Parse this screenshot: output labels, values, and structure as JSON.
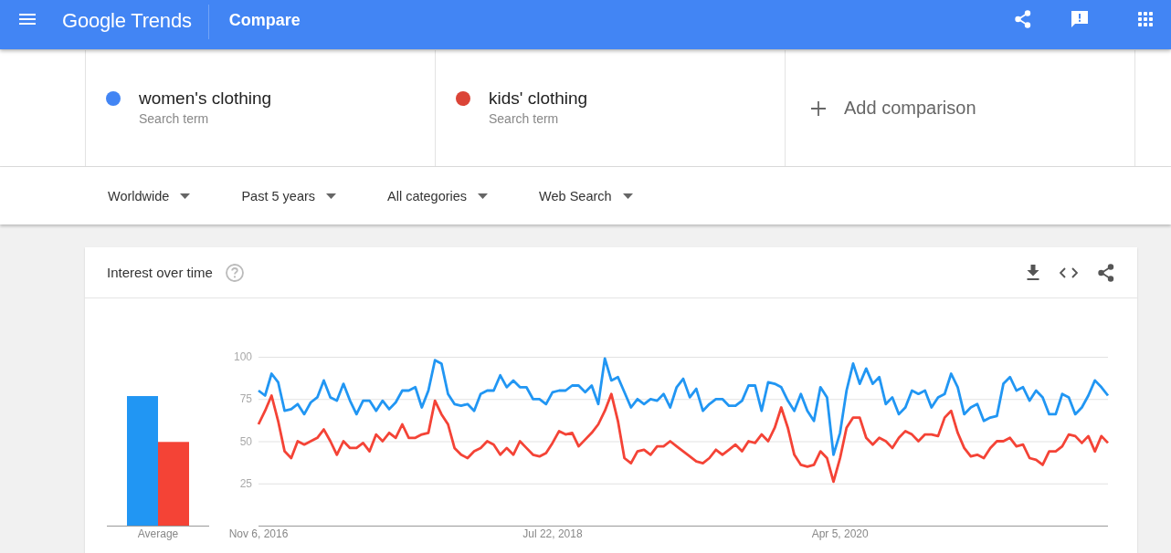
{
  "top_bar": {
    "product_name": "Google Trends",
    "page_title": "Compare"
  },
  "search_terms": [
    {
      "term": "women's clothing",
      "caption": "Search term",
      "color": "#4285f4"
    },
    {
      "term": "kids' clothing",
      "caption": "Search term",
      "color": "#db4437"
    }
  ],
  "add_comparison": {
    "label": "Add comparison"
  },
  "filters": [
    {
      "label": "Worldwide"
    },
    {
      "label": "Past 5 years"
    },
    {
      "label": "All categories"
    },
    {
      "label": "Web Search"
    }
  ],
  "interest_over_time": {
    "title": "Interest over time",
    "average_label": "Average",
    "chart_data": {
      "type": "line",
      "grid": true,
      "categories": [
        "Nov 6, 2016",
        null,
        null,
        null,
        null,
        null,
        null,
        null,
        null,
        null,
        null,
        null,
        null,
        null,
        null,
        null,
        null,
        null,
        null,
        null,
        null,
        null,
        null,
        null,
        null,
        null,
        null,
        null,
        null,
        null,
        null,
        null,
        null,
        null,
        null,
        null,
        null,
        null,
        null,
        null,
        null,
        null,
        null,
        null,
        null,
        "Jul 22, 2018",
        null,
        null,
        null,
        null,
        null,
        null,
        null,
        null,
        null,
        null,
        null,
        null,
        null,
        null,
        null,
        null,
        null,
        null,
        null,
        null,
        null,
        null,
        null,
        null,
        null,
        null,
        null,
        null,
        null,
        null,
        null,
        null,
        null,
        null,
        null,
        null,
        null,
        null,
        null,
        null,
        null,
        null,
        null,
        "Apr 5, 2020",
        null,
        null,
        null,
        null,
        null,
        null,
        null,
        null,
        null,
        null,
        null,
        null,
        null,
        null,
        null,
        null,
        null,
        null,
        null,
        null,
        null,
        null,
        null,
        null,
        null,
        null,
        null,
        null,
        null,
        null,
        null,
        null,
        null,
        null,
        null,
        null,
        null,
        null,
        null,
        null,
        null
      ],
      "ylim": [
        0,
        100
      ],
      "yticks": [
        25,
        50,
        75,
        100
      ],
      "series": [
        {
          "color": "#2196f3",
          "values": [
            80,
            77,
            90,
            85,
            68,
            69,
            72,
            66,
            73,
            76,
            86,
            76,
            74,
            84,
            74,
            66,
            74,
            74,
            68,
            74,
            69,
            73,
            80,
            80,
            82,
            70,
            80,
            98,
            96,
            78,
            72,
            71,
            72,
            68,
            78,
            80,
            80,
            89,
            82,
            86,
            82,
            82,
            75,
            75,
            72,
            79,
            80,
            80,
            83,
            83,
            79,
            83,
            72,
            99,
            86,
            88,
            79,
            70,
            75,
            72,
            75,
            74,
            78,
            70,
            82,
            87,
            76,
            81,
            68,
            72,
            75,
            75,
            71,
            71,
            74,
            83,
            83,
            68,
            85,
            84,
            82,
            74,
            68,
            78,
            68,
            62,
            82,
            76,
            42,
            55,
            80,
            96,
            84,
            93,
            84,
            88,
            72,
            76,
            66,
            70,
            80,
            78,
            80,
            70,
            76,
            78,
            90,
            82,
            66,
            70,
            72,
            62,
            64,
            65,
            84,
            88,
            80,
            82,
            74,
            80,
            76,
            66,
            66,
            78,
            76,
            66,
            70,
            77,
            86,
            82,
            77
          ]
        },
        {
          "color": "#f44336",
          "values": [
            60,
            68,
            77,
            62,
            44,
            40,
            50,
            48,
            50,
            52,
            57,
            50,
            42,
            50,
            46,
            46,
            49,
            44,
            54,
            50,
            55,
            52,
            60,
            52,
            52,
            54,
            55,
            74,
            66,
            60,
            46,
            42,
            40,
            44,
            46,
            50,
            48,
            42,
            46,
            42,
            50,
            46,
            42,
            41,
            43,
            49,
            56,
            54,
            55,
            47,
            51,
            55,
            60,
            68,
            78,
            62,
            40,
            37,
            44,
            45,
            42,
            47,
            47,
            50,
            47,
            44,
            41,
            38,
            37,
            40,
            45,
            42,
            45,
            48,
            44,
            50,
            49,
            54,
            50,
            58,
            70,
            58,
            42,
            36,
            35,
            36,
            44,
            40,
            26,
            40,
            58,
            64,
            64,
            52,
            48,
            52,
            50,
            46,
            52,
            56,
            54,
            50,
            54,
            54,
            53,
            64,
            68,
            55,
            46,
            41,
            42,
            40,
            46,
            50,
            50,
            52,
            47,
            48,
            40,
            39,
            36,
            44,
            44,
            47,
            54,
            53,
            49,
            53,
            44,
            53,
            49
          ]
        }
      ]
    }
  }
}
